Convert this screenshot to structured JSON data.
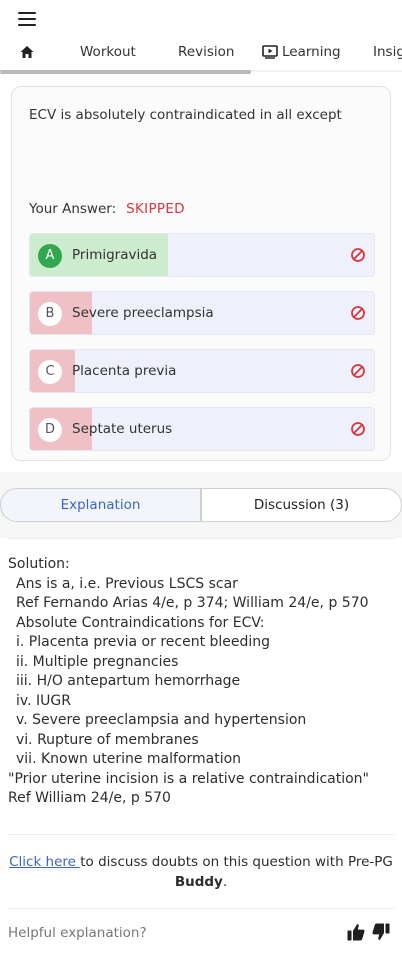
{
  "nav": {
    "tabs": [
      {
        "label": ""
      },
      {
        "label": "Workout"
      },
      {
        "label": "Revision"
      },
      {
        "label": "Learning"
      },
      {
        "label": "Insig"
      }
    ]
  },
  "question": {
    "text": "ECV is absolutely contraindicated in all except",
    "answer_label": "Your Answer:",
    "answer_status": "SKIPPED",
    "options": [
      {
        "letter": "A",
        "text": "Primigravida",
        "percent": 40,
        "correct": true
      },
      {
        "letter": "B",
        "text": "Severe preeclampsia",
        "percent": 18,
        "correct": false
      },
      {
        "letter": "C",
        "text": "Placenta previa",
        "percent": 13,
        "correct": false
      },
      {
        "letter": "D",
        "text": "Septate uterus",
        "percent": 18,
        "correct": false
      }
    ]
  },
  "segments": {
    "explanation": "Explanation",
    "discussion": "Discussion (3)"
  },
  "solution": {
    "heading": "Solution:",
    "lines": [
      " Ans is a, i.e. Previous LSCS scar",
      " Ref Fernando Arias 4/e, p 374; William 24/e, p 570",
      " Absolute Contraindications for ECV:",
      " i. Placenta previa or recent bleeding",
      " ii. Multiple pregnancies",
      " iii. H/O antepartum hemorrhage",
      " iv. IUGR",
      " v. Severe preeclampsia and hypertension",
      " vi. Rupture of membranes",
      " vii. Known uterine malformation"
    ],
    "quote": "\"Prior uterine incision is a relative contraindication\"",
    "ref": "Ref William 24/e, p 570"
  },
  "discuss": {
    "link": "Click here ",
    "text": "to discuss doubts on this question with Pre-PG ",
    "brand": "Buddy",
    "end": "."
  },
  "feedback": {
    "label": "Helpful explanation?"
  },
  "colors": {
    "accent": "#3b63c8",
    "skipped": "#d9363e",
    "correct": "#2fa84f"
  }
}
